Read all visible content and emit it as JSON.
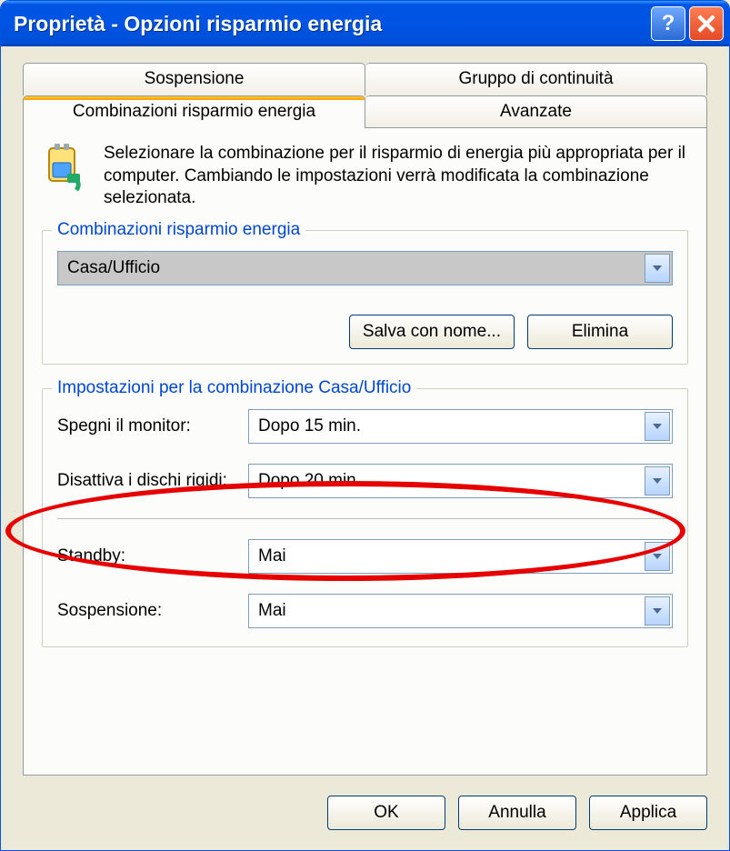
{
  "window": {
    "title": "Proprietà - Opzioni risparmio energia"
  },
  "tabs": {
    "top": [
      "Sospensione",
      "Gruppo di continuità"
    ],
    "bottom": [
      "Combinazioni risparmio energia",
      "Avanzate"
    ],
    "active": "Combinazioni risparmio energia"
  },
  "intro": "Selezionare la combinazione per il risparmio di energia più appropriata per il computer. Cambiando le impostazioni verrà modificata la combinazione selezionata.",
  "group_schemes": {
    "legend": "Combinazioni risparmio energia",
    "selected": "Casa/Ufficio",
    "save_as": "Salva con nome...",
    "delete": "Elimina"
  },
  "group_settings": {
    "legend": "Impostazioni per la combinazione Casa/Ufficio",
    "rows": {
      "monitor": {
        "label": "Spegni il monitor:",
        "value": "Dopo 15 min."
      },
      "disks": {
        "label": "Disattiva i dischi rigidi:",
        "value": "Dopo 20 min."
      },
      "standby": {
        "label": "Standby:",
        "value": "Mai"
      },
      "hibernate": {
        "label": "Sospensione:",
        "value": "Mai"
      }
    }
  },
  "footer": {
    "ok": "OK",
    "cancel": "Annulla",
    "apply": "Applica"
  },
  "annotation": {
    "shape": "ellipse",
    "color": "#e60000",
    "target": "monitor-row-and-legend"
  }
}
